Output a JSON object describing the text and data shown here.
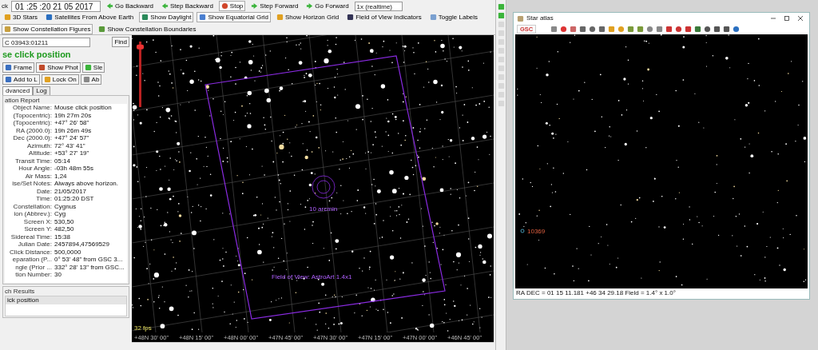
{
  "toolbar": {
    "label": "ck",
    "time": "01 :25 :20  21  05  2017",
    "speed": "1x (realtime)",
    "buttons": [
      {
        "label": "Go Backward",
        "on": false
      },
      {
        "label": "Step Backward",
        "on": false
      },
      {
        "label": "Stop",
        "on": true
      },
      {
        "label": "Step Forward",
        "on": false
      },
      {
        "label": "Go Forward",
        "on": false
      }
    ]
  },
  "toggles": [
    {
      "label": "3D Stars",
      "on": false
    },
    {
      "label": "Satellites From Above Earth",
      "on": false
    },
    {
      "label": "Show Daylight",
      "on": true
    },
    {
      "label": "Show Equatorial Grid",
      "on": true
    },
    {
      "label": "Show Horizon Grid",
      "on": false
    },
    {
      "label": "Field of View Indicators",
      "on": false
    },
    {
      "label": "Toggle Labels",
      "on": false
    },
    {
      "label": "Show Constellation Figures",
      "on": true
    },
    {
      "label": "Show Constellation Boundaries",
      "on": false
    }
  ],
  "side_panel": {
    "object_field": "C 03943:01211",
    "find": "Find",
    "heading": "se click position",
    "actions": [
      {
        "label": "Frame"
      },
      {
        "label": "Show Phot"
      },
      {
        "label": "Sle"
      },
      {
        "label": "Add to L"
      },
      {
        "label": "Lock On"
      },
      {
        "label": "Ab"
      }
    ],
    "tabs": [
      {
        "label": "dvanced",
        "selected": true
      },
      {
        "label": "Log",
        "selected": false
      }
    ],
    "report": {
      "title": "ation Report",
      "rows": [
        {
          "key": "Object Name:",
          "value": "Mouse click position"
        },
        {
          "key": "(Topocentric):",
          "value": "19h 27m 20s"
        },
        {
          "key": "(Topocentric):",
          "value": "+47° 26' 58\""
        },
        {
          "key": "RA (2000.0):",
          "value": "19h 26m 49s"
        },
        {
          "key": "Dec (2000.0):",
          "value": "+47° 24' 57\""
        },
        {
          "key": "Azimuth:",
          "value": "72° 43' 41\""
        },
        {
          "key": "Altitude:",
          "value": "+53° 27' 19\""
        },
        {
          "key": "Transit Time:",
          "value": "05:14"
        },
        {
          "key": "Hour Angle:",
          "value": "-03h 48m 55s"
        },
        {
          "key": "Air Mass:",
          "value": "1,24"
        },
        {
          "key": "ise/Set Notes:",
          "value": "Always above horizon."
        },
        {
          "key": "Date:",
          "value": "21/05/2017"
        },
        {
          "key": "Time:",
          "value": "01:25:20 DST"
        },
        {
          "key": "Constellation:",
          "value": "Cygnus"
        },
        {
          "key": "ion (Abbrev.):",
          "value": "Cyg"
        },
        {
          "key": "Screen X:",
          "value": "530,50"
        },
        {
          "key": "Screen Y:",
          "value": "482,50"
        },
        {
          "key": "Sidereal Time:",
          "value": "15:38"
        },
        {
          "key": "Julian Date:",
          "value": "2457894,47569529"
        },
        {
          "key": "Click Distance:",
          "value": "500,0000"
        },
        {
          "key": "eparation (P...",
          "value": "0° 53' 48\" from GSC 3..."
        },
        {
          "key": "ngle (Prior ...",
          "value": "332° 28' 13\" from GSC..."
        },
        {
          "key": "tion Number:",
          "value": "30"
        }
      ]
    },
    "results": {
      "title": "ch Results",
      "items": [
        {
          "label": "ick position",
          "selected": true
        }
      ]
    }
  },
  "sky_view": {
    "zoom_slider": {
      "level": 0.95
    },
    "fps": "32 fps",
    "circle_label": "10 arcmin",
    "fov_label": "Field of View: AstroArt 1.4x1",
    "axis_labels": [
      "+48N 30' 00\"",
      "+48N 15' 00\"",
      "+48N 00' 00\"",
      "+47N 45' 00\"",
      "+47N 30' 00\"",
      "+47N 15' 00\"",
      "+47N 00' 00\"",
      "+46N 45' 00\""
    ]
  },
  "star_atlas": {
    "title": "Star atlas",
    "catalog_button": "GSC",
    "marker_label": "10369",
    "status": "RA DEC  =  01 15 11.181 +46 34 29.18  Field  =  1.4° x 1.0°"
  }
}
